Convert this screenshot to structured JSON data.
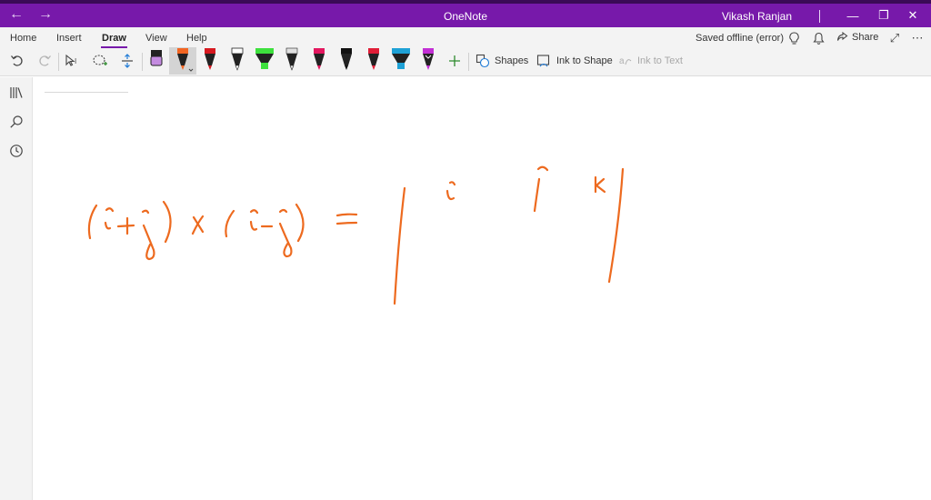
{
  "titlebar": {
    "app_title": "OneNote",
    "user": "Vikash Ranjan",
    "back_icon": "arrow-left-icon",
    "forward_icon": "arrow-right-icon",
    "background": "#7719aa"
  },
  "tabs": [
    {
      "label": "Home"
    },
    {
      "label": "Insert"
    },
    {
      "label": "Draw",
      "active": true
    },
    {
      "label": "View"
    },
    {
      "label": "Help"
    }
  ],
  "status": {
    "sync_text": "Saved offline (error)",
    "share_label": "Share"
  },
  "draw_toolbar": {
    "shapes_label": "Shapes",
    "ink_to_shape_label": "Ink to Shape",
    "ink_to_text_label": "Ink to Text",
    "pens": [
      {
        "type": "pencil",
        "color": "#c48be0"
      },
      {
        "type": "pen",
        "color": "#f26522",
        "selected": true
      },
      {
        "type": "pen",
        "color": "#d71920"
      },
      {
        "type": "pen",
        "color": "#ffffff"
      },
      {
        "type": "highlighter",
        "color": "#3de03d"
      },
      {
        "type": "pen",
        "color": "#e0e0e0"
      },
      {
        "type": "pen",
        "color": "#e3175f"
      },
      {
        "type": "pen",
        "color": "#111111"
      },
      {
        "type": "pen",
        "color": "#e01e37"
      },
      {
        "type": "highlighter",
        "color": "#1ea1d6"
      },
      {
        "type": "pen",
        "color": "#c22fd4"
      }
    ]
  },
  "ink": {
    "color": "#ed6a1f"
  }
}
